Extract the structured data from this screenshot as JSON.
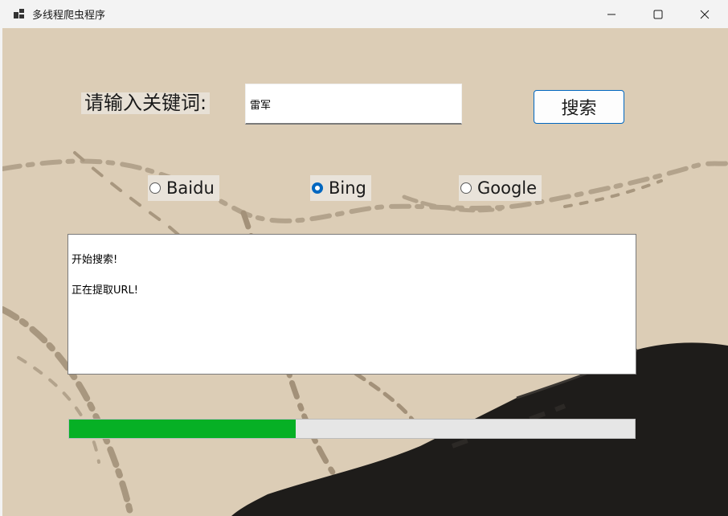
{
  "window": {
    "title": "多线程爬虫程序",
    "icon": "app-window-icon",
    "controls": [
      "minimize-icon",
      "maximize-icon",
      "close-icon"
    ]
  },
  "form": {
    "keyword_label": "请输入关键词:",
    "keyword_value": "雷军",
    "search_button_label": "搜索"
  },
  "engines": [
    {
      "label": "Baidu",
      "checked": false
    },
    {
      "label": "Bing",
      "checked": true
    },
    {
      "label": "Google",
      "checked": false
    }
  ],
  "log": {
    "lines": [
      "开始搜索!",
      "正在提取URL!"
    ]
  },
  "progress": {
    "fraction": 0.4
  },
  "colors": {
    "accent": "#0067c0",
    "progress_fill": "#06b025",
    "background": "#dccdb6"
  }
}
